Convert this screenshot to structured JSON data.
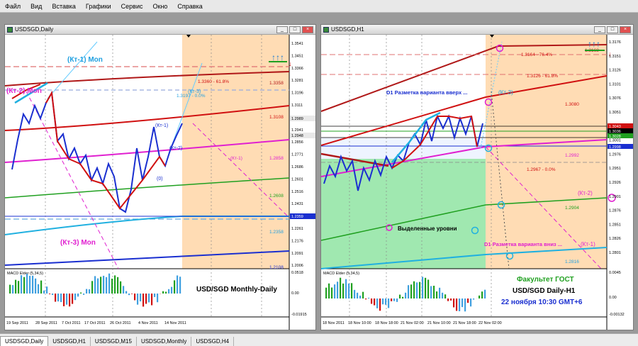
{
  "menu": [
    "Файл",
    "Вид",
    "Вставка",
    "Графики",
    "Сервис",
    "Окно",
    "Справка"
  ],
  "tabs": [
    "USDSGD,Daily",
    "USDSGD,H1",
    "USDSGD,M15",
    "USDSGD,Monthly",
    "USDSGD,H4"
  ],
  "left": {
    "title": "USDSGD,Daily",
    "price_scale": [
      "1.3541",
      "1.3451",
      "1.3366",
      "1.3281",
      "1.3196",
      "1.3111",
      "1.3026",
      "1.2941",
      "1.2856",
      "1.2771",
      "1.2686",
      "1.2601",
      "1.2516",
      "1.2431",
      "1.2346",
      "1.2261",
      "1.2176",
      "1.2091",
      "1.2006"
    ],
    "price_tags": {
      "upper": "1.2989",
      "red": "1.2948",
      "blue": "1.2359"
    },
    "level_labels": [
      "1.3358",
      "1.3108",
      "1.2858",
      "1.2608",
      "1.2358",
      "1.2108"
    ],
    "fib_labels": [
      "1.3360 - 61.8%",
      "1.3197 - 0.0%"
    ],
    "wave_labels": {
      "kt1mon": "(Кт-1) Mon",
      "kt2mon": "(Кт-2) Mon",
      "kt3mon": "(Кт-3) Mon",
      "kt3": "(Кт-3)",
      "kt1": "(Кт-1)",
      "kt2": "(Кт-2)",
      "zero": "(0)",
      "kt1b": "(Кт-1)"
    },
    "macd": {
      "label": "MACD Elder (5,34,5)",
      "max": "0.0518",
      "zero": "0.00",
      "min": "-0.01915"
    },
    "caption": "USD/SGD Monthly-Daily",
    "x_axis": [
      "19 Sep 2011",
      "28 Sep 2011",
      "7 Oct 2011",
      "17 Oct 2011",
      "26 Oct 2011",
      "4 Nov 2011",
      "14 Nov 2011"
    ]
  },
  "right": {
    "title": "USDSGD,H1",
    "price_scale": [
      "1.3176",
      "1.3151",
      "1.3126",
      "1.3101",
      "1.3076",
      "1.3051",
      "1.3026",
      "1.3001",
      "1.2976",
      "1.2951",
      "1.2926",
      "1.2901",
      "1.2876",
      "1.2851",
      "1.2826",
      "1.2801"
    ],
    "price_tags": {
      "t1": "1.3043",
      "t2": "1.3036",
      "t3": "1.3028",
      "t4": "1.2998"
    },
    "level_labels": [
      "1.3168",
      "1.3080",
      "1.2992",
      "1.2904",
      "1.2816"
    ],
    "fib_labels": [
      "1.3164 - 76.4%",
      "1.3126 - 61.8%",
      "1.2967 - 0.0%"
    ],
    "annotations": {
      "up": "D1 Разметка варианта вверх ...",
      "kt3": "(Кт-3)",
      "down": "D1 Разметка варианта вниз ...",
      "kt1": "(Кт-1)",
      "kt2": "(Кт-2)",
      "levels": "Выделенные уровни"
    },
    "macd": {
      "label": "MACD Elder (5,34,5)",
      "max": "0.0045",
      "zero": "0.00",
      "min": "-0.00132"
    },
    "caption": {
      "line1": "Факультет ГОСТ",
      "line2": "USD/SGD Daily-H1",
      "line3": "22  ноября 10:30  GMT+6"
    },
    "x_axis": [
      "18 Nov 2011",
      "18 Nov 10:00",
      "18 Nov 18:00",
      "21 Nov 02:00",
      "21 Nov 10:00",
      "21 Nov 18:00",
      "22 Nov 02:00"
    ]
  },
  "colors": {
    "bull": "#1a2fd0",
    "bear": "#d01010",
    "magenta": "#e020d0",
    "green": "#20a020",
    "cyan": "#20b0e0",
    "dred": "#b01818",
    "orange": "#ffdcb4",
    "lgreen": "#a0e8b0"
  }
}
